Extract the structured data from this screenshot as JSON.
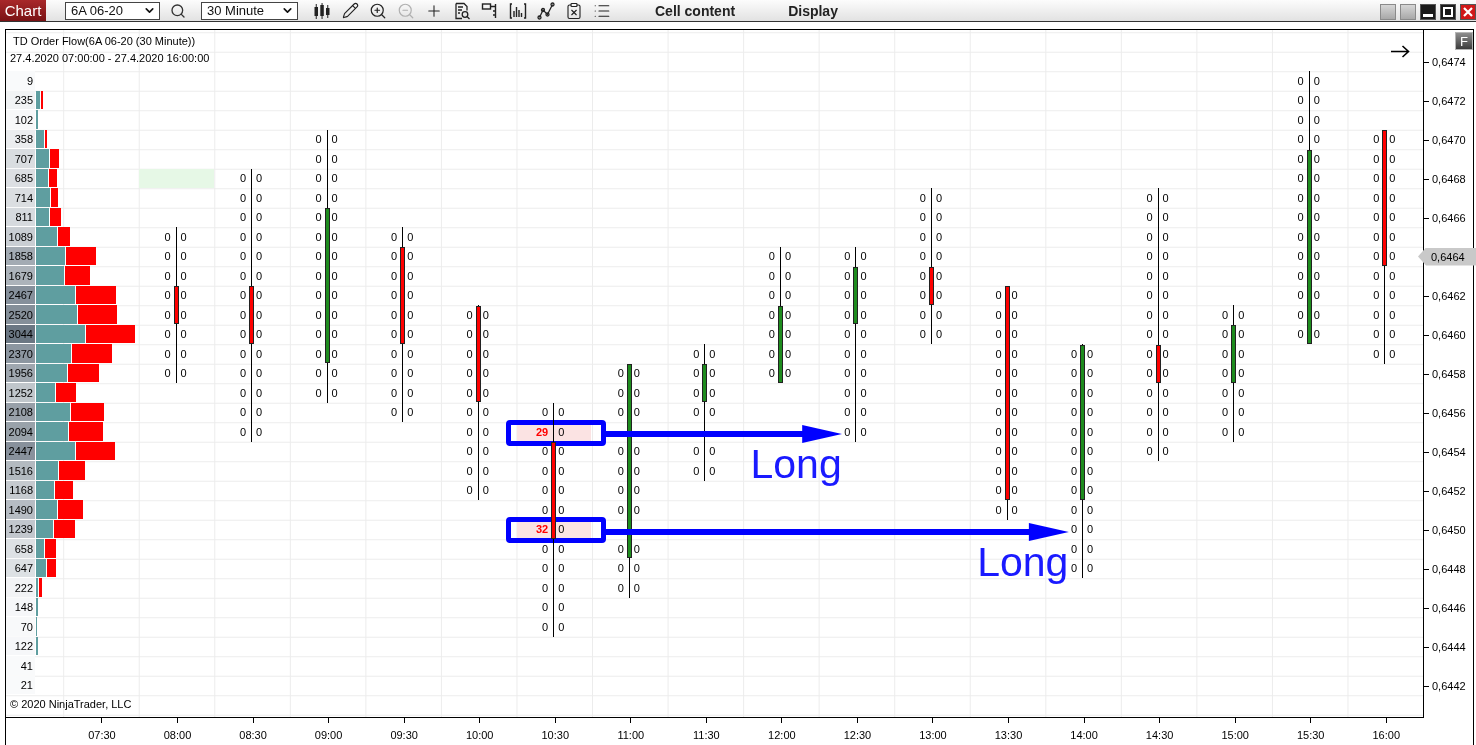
{
  "toolbar": {
    "tab": "Chart",
    "instrument": "6A 06-20",
    "interval": "30 Minute",
    "tools": [
      {
        "disabled": false
      },
      {
        "disabled": false
      },
      {
        "disabled": false
      },
      {
        "disabled": true
      },
      {
        "disabled": false
      },
      {
        "disabled": false
      },
      {
        "disabled": false
      },
      {
        "disabled": false
      },
      {
        "disabled": false
      },
      {
        "disabled": false
      },
      {
        "disabled": false
      }
    ],
    "menus": [
      "Cell content",
      "Display"
    ]
  },
  "chart": {
    "title": "TD Order Flow(6A 06-20 (30 Minute))",
    "range": "27.4.2020 07:00:00 - 27.4.2020 16:00:00",
    "copyright": "© 2020 NinjaTrader, LLC",
    "columns": [
      {
        "time": "07:30"
      },
      {
        "time": "08:00",
        "rising": false
      },
      {
        "time": "08:30",
        "rising": false
      },
      {
        "time": "09:00",
        "rising": true
      },
      {
        "time": "09:30",
        "rising": false
      },
      {
        "time": "10:00",
        "rising": false
      },
      {
        "time": "10:30",
        "rising": false
      },
      {
        "time": "11:00",
        "rising": true
      },
      {
        "time": "11:30",
        "rising": true
      },
      {
        "time": "12:00",
        "rising": true
      },
      {
        "time": "12:30",
        "rising": true
      },
      {
        "time": "13:00",
        "rising": false
      },
      {
        "time": "13:30",
        "rising": false
      },
      {
        "time": "14:00",
        "rising": true
      },
      {
        "time": "14:30",
        "rising": false
      },
      {
        "time": "15:00",
        "rising": true
      },
      {
        "time": "15:30",
        "rising": true
      },
      {
        "time": "16:00",
        "rising": false
      }
    ],
    "rows": [
      {
        "volume": "9",
        "cells": [
          null,
          null,
          null,
          null,
          null,
          null,
          null,
          null,
          null,
          null,
          null,
          null,
          null,
          null,
          null,
          null,
          {
            "kind": "plain",
            "bid": "0",
            "ask": "0",
            "body": false,
            "imbalance": false
          },
          null
        ]
      },
      {
        "volume": "235",
        "cells": [
          null,
          null,
          null,
          null,
          null,
          null,
          null,
          null,
          null,
          null,
          null,
          null,
          null,
          null,
          null,
          null,
          {
            "kind": "plain",
            "bid": "0",
            "ask": "0",
            "body": false,
            "imbalance": false
          },
          null
        ]
      },
      {
        "volume": "102",
        "cells": [
          null,
          null,
          null,
          null,
          null,
          null,
          null,
          null,
          null,
          null,
          null,
          null,
          null,
          null,
          null,
          null,
          {
            "kind": "plain",
            "bid": "0",
            "ask": "0",
            "body": false,
            "imbalance": false
          },
          null
        ]
      },
      {
        "volume": "358",
        "cells": [
          null,
          null,
          null,
          {
            "kind": "plain",
            "bid": "0",
            "ask": "0",
            "body": false,
            "imbalance": false
          },
          null,
          null,
          null,
          null,
          null,
          null,
          null,
          null,
          null,
          null,
          null,
          null,
          {
            "kind": "plain",
            "bid": "0",
            "ask": "0",
            "body": false,
            "imbalance": false
          },
          {
            "kind": "plain",
            "bid": "0",
            "ask": "0",
            "body": true,
            "imbalance": false
          }
        ]
      },
      {
        "volume": "707",
        "cells": [
          null,
          null,
          null,
          {
            "kind": "plain",
            "bid": "0",
            "ask": "0",
            "body": false,
            "imbalance": false
          },
          null,
          null,
          null,
          null,
          null,
          null,
          null,
          null,
          null,
          null,
          null,
          null,
          {
            "kind": "plain",
            "bid": "0",
            "ask": "0",
            "body": true,
            "imbalance": false
          },
          {
            "kind": "plain",
            "bid": "0",
            "ask": "0",
            "body": true,
            "imbalance": false
          }
        ]
      },
      {
        "volume": "685",
        "cells": [
          null,
          {
            "kind": "marker"
          },
          {
            "kind": "plain",
            "bid": "0",
            "ask": "0",
            "body": false,
            "imbalance": false
          },
          {
            "kind": "plain",
            "bid": "0",
            "ask": "0",
            "body": false,
            "imbalance": false
          },
          null,
          null,
          null,
          null,
          null,
          null,
          null,
          null,
          null,
          null,
          null,
          null,
          {
            "kind": "plain",
            "bid": "0",
            "ask": "0",
            "body": true,
            "imbalance": false
          },
          {
            "kind": "plain",
            "bid": "0",
            "ask": "0",
            "body": true,
            "imbalance": false
          }
        ]
      },
      {
        "volume": "714",
        "cells": [
          null,
          null,
          {
            "kind": "plain",
            "bid": "0",
            "ask": "0",
            "body": false,
            "imbalance": false
          },
          {
            "kind": "plain",
            "bid": "0",
            "ask": "0",
            "body": false,
            "imbalance": false
          },
          null,
          null,
          null,
          null,
          null,
          null,
          null,
          {
            "kind": "plain",
            "bid": "0",
            "ask": "0",
            "body": false,
            "imbalance": false
          },
          null,
          null,
          {
            "kind": "plain",
            "bid": "0",
            "ask": "0",
            "body": false,
            "imbalance": false
          },
          null,
          {
            "kind": "plain",
            "bid": "0",
            "ask": "0",
            "body": true,
            "imbalance": false
          },
          {
            "kind": "plain",
            "bid": "0",
            "ask": "0",
            "body": true,
            "imbalance": false
          }
        ]
      },
      {
        "volume": "811",
        "cells": [
          null,
          null,
          {
            "kind": "plain",
            "bid": "0",
            "ask": "0",
            "body": false,
            "imbalance": false
          },
          {
            "kind": "plain",
            "bid": "0",
            "ask": "0",
            "body": true,
            "imbalance": false
          },
          null,
          null,
          null,
          null,
          null,
          null,
          null,
          {
            "kind": "plain",
            "bid": "0",
            "ask": "0",
            "body": false,
            "imbalance": false
          },
          null,
          null,
          {
            "kind": "plain",
            "bid": "0",
            "ask": "0",
            "body": false,
            "imbalance": false
          },
          null,
          {
            "kind": "plain",
            "bid": "0",
            "ask": "0",
            "body": true,
            "imbalance": false
          },
          {
            "kind": "plain",
            "bid": "0",
            "ask": "0",
            "body": true,
            "imbalance": false
          }
        ]
      },
      {
        "volume": "1089",
        "cells": [
          null,
          {
            "kind": "plain",
            "bid": "0",
            "ask": "0",
            "body": false,
            "imbalance": false
          },
          {
            "kind": "plain",
            "bid": "0",
            "ask": "0",
            "body": false,
            "imbalance": false
          },
          {
            "kind": "plain",
            "bid": "0",
            "ask": "0",
            "body": true,
            "imbalance": false
          },
          {
            "kind": "plain",
            "bid": "0",
            "ask": "0",
            "body": false,
            "imbalance": false
          },
          null,
          null,
          null,
          null,
          null,
          null,
          {
            "kind": "plain",
            "bid": "0",
            "ask": "0",
            "body": false,
            "imbalance": false
          },
          null,
          null,
          {
            "kind": "plain",
            "bid": "0",
            "ask": "0",
            "body": false,
            "imbalance": false
          },
          null,
          {
            "kind": "plain",
            "bid": "0",
            "ask": "0",
            "body": true,
            "imbalance": false
          },
          {
            "kind": "plain",
            "bid": "0",
            "ask": "0",
            "body": true,
            "imbalance": false
          }
        ]
      },
      {
        "volume": "1858",
        "cells": [
          null,
          {
            "kind": "plain",
            "bid": "0",
            "ask": "0",
            "body": false,
            "imbalance": false
          },
          {
            "kind": "plain",
            "bid": "0",
            "ask": "0",
            "body": false,
            "imbalance": false
          },
          {
            "kind": "plain",
            "bid": "0",
            "ask": "0",
            "body": true,
            "imbalance": false
          },
          {
            "kind": "plain",
            "bid": "0",
            "ask": "0",
            "body": true,
            "imbalance": false
          },
          null,
          null,
          null,
          null,
          {
            "kind": "plain",
            "bid": "0",
            "ask": "0",
            "body": false,
            "imbalance": false
          },
          {
            "kind": "plain",
            "bid": "0",
            "ask": "0",
            "body": false,
            "imbalance": false
          },
          {
            "kind": "plain",
            "bid": "0",
            "ask": "0",
            "body": false,
            "imbalance": false
          },
          null,
          null,
          {
            "kind": "plain",
            "bid": "0",
            "ask": "0",
            "body": false,
            "imbalance": false
          },
          null,
          {
            "kind": "plain",
            "bid": "0",
            "ask": "0",
            "body": true,
            "imbalance": false
          },
          {
            "kind": "plain",
            "bid": "0",
            "ask": "0",
            "body": true,
            "imbalance": false
          }
        ]
      },
      {
        "volume": "1679",
        "cells": [
          null,
          {
            "kind": "plain",
            "bid": "0",
            "ask": "0",
            "body": false,
            "imbalance": false
          },
          {
            "kind": "plain",
            "bid": "0",
            "ask": "0",
            "body": false,
            "imbalance": false
          },
          {
            "kind": "plain",
            "bid": "0",
            "ask": "0",
            "body": true,
            "imbalance": false
          },
          {
            "kind": "plain",
            "bid": "0",
            "ask": "0",
            "body": true,
            "imbalance": false
          },
          null,
          null,
          null,
          null,
          {
            "kind": "plain",
            "bid": "0",
            "ask": "0",
            "body": false,
            "imbalance": false
          },
          {
            "kind": "plain",
            "bid": "0",
            "ask": "0",
            "body": true,
            "imbalance": false
          },
          {
            "kind": "plain",
            "bid": "0",
            "ask": "0",
            "body": true,
            "imbalance": false
          },
          null,
          null,
          {
            "kind": "plain",
            "bid": "0",
            "ask": "0",
            "body": false,
            "imbalance": false
          },
          null,
          {
            "kind": "plain",
            "bid": "0",
            "ask": "0",
            "body": true,
            "imbalance": false
          },
          {
            "kind": "plain",
            "bid": "0",
            "ask": "0",
            "body": false,
            "imbalance": false
          }
        ]
      },
      {
        "volume": "2467",
        "cells": [
          null,
          {
            "kind": "plain",
            "bid": "0",
            "ask": "0",
            "body": true,
            "imbalance": false
          },
          {
            "kind": "plain",
            "bid": "0",
            "ask": "0",
            "body": true,
            "imbalance": false
          },
          {
            "kind": "plain",
            "bid": "0",
            "ask": "0",
            "body": true,
            "imbalance": false
          },
          {
            "kind": "plain",
            "bid": "0",
            "ask": "0",
            "body": true,
            "imbalance": false
          },
          null,
          null,
          null,
          null,
          {
            "kind": "plain",
            "bid": "0",
            "ask": "0",
            "body": false,
            "imbalance": false
          },
          {
            "kind": "plain",
            "bid": "0",
            "ask": "0",
            "body": true,
            "imbalance": false
          },
          {
            "kind": "plain",
            "bid": "0",
            "ask": "0",
            "body": true,
            "imbalance": false
          },
          {
            "kind": "plain",
            "bid": "0",
            "ask": "0",
            "body": true,
            "imbalance": false
          },
          null,
          {
            "kind": "plain",
            "bid": "0",
            "ask": "0",
            "body": false,
            "imbalance": false
          },
          null,
          {
            "kind": "plain",
            "bid": "0",
            "ask": "0",
            "body": true,
            "imbalance": false
          },
          {
            "kind": "plain",
            "bid": "0",
            "ask": "0",
            "body": false,
            "imbalance": false
          }
        ]
      },
      {
        "volume": "2520",
        "cells": [
          null,
          {
            "kind": "plain",
            "bid": "0",
            "ask": "0",
            "body": true,
            "imbalance": false
          },
          {
            "kind": "plain",
            "bid": "0",
            "ask": "0",
            "body": true,
            "imbalance": false
          },
          {
            "kind": "plain",
            "bid": "0",
            "ask": "0",
            "body": true,
            "imbalance": false
          },
          {
            "kind": "plain",
            "bid": "0",
            "ask": "0",
            "body": true,
            "imbalance": false
          },
          {
            "kind": "plain",
            "bid": "0",
            "ask": "0",
            "body": true,
            "imbalance": false
          },
          null,
          null,
          null,
          {
            "kind": "plain",
            "bid": "0",
            "ask": "0",
            "body": true,
            "imbalance": false
          },
          {
            "kind": "plain",
            "bid": "0",
            "ask": "0",
            "body": true,
            "imbalance": false
          },
          {
            "kind": "plain",
            "bid": "0",
            "ask": "0",
            "body": false,
            "imbalance": false
          },
          {
            "kind": "plain",
            "bid": "0",
            "ask": "0",
            "body": true,
            "imbalance": false
          },
          null,
          {
            "kind": "plain",
            "bid": "0",
            "ask": "0",
            "body": false,
            "imbalance": false
          },
          {
            "kind": "plain",
            "bid": "0",
            "ask": "0",
            "body": false,
            "imbalance": false
          },
          {
            "kind": "plain",
            "bid": "0",
            "ask": "0",
            "body": true,
            "imbalance": false
          },
          {
            "kind": "plain",
            "bid": "0",
            "ask": "0",
            "body": false,
            "imbalance": false
          }
        ]
      },
      {
        "volume": "3044",
        "cells": [
          null,
          {
            "kind": "plain",
            "bid": "0",
            "ask": "0",
            "body": false,
            "imbalance": false
          },
          {
            "kind": "plain",
            "bid": "0",
            "ask": "0",
            "body": true,
            "imbalance": false
          },
          {
            "kind": "plain",
            "bid": "0",
            "ask": "0",
            "body": true,
            "imbalance": false
          },
          {
            "kind": "plain",
            "bid": "0",
            "ask": "0",
            "body": true,
            "imbalance": false
          },
          {
            "kind": "plain",
            "bid": "0",
            "ask": "0",
            "body": true,
            "imbalance": false
          },
          null,
          null,
          null,
          {
            "kind": "plain",
            "bid": "0",
            "ask": "0",
            "body": true,
            "imbalance": false
          },
          {
            "kind": "plain",
            "bid": "0",
            "ask": "0",
            "body": false,
            "imbalance": false
          },
          {
            "kind": "plain",
            "bid": "0",
            "ask": "0",
            "body": false,
            "imbalance": false
          },
          {
            "kind": "plain",
            "bid": "0",
            "ask": "0",
            "body": true,
            "imbalance": false
          },
          null,
          {
            "kind": "plain",
            "bid": "0",
            "ask": "0",
            "body": false,
            "imbalance": false
          },
          {
            "kind": "plain",
            "bid": "0",
            "ask": "0",
            "body": true,
            "imbalance": false
          },
          {
            "kind": "plain",
            "bid": "0",
            "ask": "0",
            "body": true,
            "imbalance": false
          },
          {
            "kind": "plain",
            "bid": "0",
            "ask": "0",
            "body": false,
            "imbalance": false
          }
        ]
      },
      {
        "volume": "2370",
        "cells": [
          null,
          {
            "kind": "plain",
            "bid": "0",
            "ask": "0",
            "body": false,
            "imbalance": false
          },
          {
            "kind": "plain",
            "bid": "0",
            "ask": "0",
            "body": false,
            "imbalance": false
          },
          {
            "kind": "plain",
            "bid": "0",
            "ask": "0",
            "body": true,
            "imbalance": false
          },
          {
            "kind": "plain",
            "bid": "0",
            "ask": "0",
            "body": false,
            "imbalance": false
          },
          {
            "kind": "plain",
            "bid": "0",
            "ask": "0",
            "body": true,
            "imbalance": false
          },
          null,
          null,
          {
            "kind": "plain",
            "bid": "0",
            "ask": "0",
            "body": false,
            "imbalance": false
          },
          {
            "kind": "plain",
            "bid": "0",
            "ask": "0",
            "body": true,
            "imbalance": false
          },
          {
            "kind": "plain",
            "bid": "0",
            "ask": "0",
            "body": false,
            "imbalance": false
          },
          null,
          {
            "kind": "plain",
            "bid": "0",
            "ask": "0",
            "body": true,
            "imbalance": false
          },
          {
            "kind": "plain",
            "bid": "0",
            "ask": "0",
            "body": true,
            "imbalance": false
          },
          {
            "kind": "plain",
            "bid": "0",
            "ask": "0",
            "body": true,
            "imbalance": false
          },
          {
            "kind": "plain",
            "bid": "0",
            "ask": "0",
            "body": true,
            "imbalance": false
          },
          null,
          {
            "kind": "plain",
            "bid": "0",
            "ask": "0",
            "body": false,
            "imbalance": false
          }
        ]
      },
      {
        "volume": "1956",
        "cells": [
          null,
          {
            "kind": "plain",
            "bid": "0",
            "ask": "0",
            "body": false,
            "imbalance": false
          },
          {
            "kind": "plain",
            "bid": "0",
            "ask": "0",
            "body": false,
            "imbalance": false
          },
          {
            "kind": "plain",
            "bid": "0",
            "ask": "0",
            "body": false,
            "imbalance": false
          },
          {
            "kind": "plain",
            "bid": "0",
            "ask": "0",
            "body": false,
            "imbalance": false
          },
          {
            "kind": "plain",
            "bid": "0",
            "ask": "0",
            "body": true,
            "imbalance": false
          },
          null,
          {
            "kind": "plain",
            "bid": "0",
            "ask": "0",
            "body": true,
            "imbalance": false
          },
          {
            "kind": "plain",
            "bid": "0",
            "ask": "0",
            "body": true,
            "imbalance": false
          },
          {
            "kind": "plain",
            "bid": "0",
            "ask": "0",
            "body": true,
            "imbalance": false
          },
          {
            "kind": "plain",
            "bid": "0",
            "ask": "0",
            "body": false,
            "imbalance": false
          },
          null,
          {
            "kind": "plain",
            "bid": "0",
            "ask": "0",
            "body": true,
            "imbalance": false
          },
          {
            "kind": "plain",
            "bid": "0",
            "ask": "0",
            "body": true,
            "imbalance": false
          },
          {
            "kind": "plain",
            "bid": "0",
            "ask": "0",
            "body": true,
            "imbalance": false
          },
          {
            "kind": "plain",
            "bid": "0",
            "ask": "0",
            "body": true,
            "imbalance": false
          },
          null,
          null
        ]
      },
      {
        "volume": "1252",
        "cells": [
          null,
          null,
          {
            "kind": "plain",
            "bid": "0",
            "ask": "0",
            "body": false,
            "imbalance": false
          },
          {
            "kind": "plain",
            "bid": "0",
            "ask": "0",
            "body": false,
            "imbalance": false
          },
          {
            "kind": "plain",
            "bid": "0",
            "ask": "0",
            "body": false,
            "imbalance": false
          },
          {
            "kind": "plain",
            "bid": "0",
            "ask": "0",
            "body": true,
            "imbalance": false
          },
          null,
          {
            "kind": "plain",
            "bid": "0",
            "ask": "0",
            "body": true,
            "imbalance": false
          },
          {
            "kind": "plain",
            "bid": "0",
            "ask": "0",
            "body": true,
            "imbalance": false
          },
          null,
          {
            "kind": "plain",
            "bid": "0",
            "ask": "0",
            "body": false,
            "imbalance": false
          },
          null,
          {
            "kind": "plain",
            "bid": "0",
            "ask": "0",
            "body": true,
            "imbalance": false
          },
          {
            "kind": "plain",
            "bid": "0",
            "ask": "0",
            "body": true,
            "imbalance": false
          },
          {
            "kind": "plain",
            "bid": "0",
            "ask": "0",
            "body": false,
            "imbalance": false
          },
          {
            "kind": "plain",
            "bid": "0",
            "ask": "0",
            "body": false,
            "imbalance": false
          },
          null,
          null
        ]
      },
      {
        "volume": "2108",
        "cells": [
          null,
          null,
          {
            "kind": "plain",
            "bid": "0",
            "ask": "0",
            "body": false,
            "imbalance": false
          },
          null,
          {
            "kind": "plain",
            "bid": "0",
            "ask": "0",
            "body": false,
            "imbalance": false
          },
          {
            "kind": "plain",
            "bid": "0",
            "ask": "0",
            "body": false,
            "imbalance": false
          },
          {
            "kind": "plain",
            "bid": "0",
            "ask": "0",
            "body": false,
            "imbalance": false
          },
          {
            "kind": "plain",
            "bid": "0",
            "ask": "0",
            "body": true,
            "imbalance": false
          },
          {
            "kind": "plain",
            "bid": "0",
            "ask": "0",
            "body": false,
            "imbalance": false
          },
          null,
          {
            "kind": "plain",
            "bid": "0",
            "ask": "0",
            "body": false,
            "imbalance": false
          },
          null,
          {
            "kind": "plain",
            "bid": "0",
            "ask": "0",
            "body": true,
            "imbalance": false
          },
          {
            "kind": "plain",
            "bid": "0",
            "ask": "0",
            "body": true,
            "imbalance": false
          },
          {
            "kind": "plain",
            "bid": "0",
            "ask": "0",
            "body": false,
            "imbalance": false
          },
          {
            "kind": "plain",
            "bid": "0",
            "ask": "0",
            "body": false,
            "imbalance": false
          },
          null,
          null
        ]
      },
      {
        "volume": "2094",
        "cells": [
          null,
          null,
          {
            "kind": "plain",
            "bid": "0",
            "ask": "0",
            "body": false,
            "imbalance": false
          },
          null,
          null,
          {
            "kind": "plain",
            "bid": "0",
            "ask": "0",
            "body": false,
            "imbalance": false
          },
          {
            "kind": "boxed",
            "bid": "29",
            "ask": "0",
            "body": false,
            "imbalance": true
          },
          {
            "kind": "covered"
          },
          {
            "kind": "covered"
          },
          null,
          {
            "kind": "target",
            "bid": "0",
            "ask": "0",
            "body": false,
            "imbalance": false,
            "label": "Long"
          },
          null,
          {
            "kind": "plain",
            "bid": "0",
            "ask": "0",
            "body": true,
            "imbalance": false
          },
          {
            "kind": "plain",
            "bid": "0",
            "ask": "0",
            "body": true,
            "imbalance": false
          },
          {
            "kind": "plain",
            "bid": "0",
            "ask": "0",
            "body": false,
            "imbalance": false
          },
          {
            "kind": "plain",
            "bid": "0",
            "ask": "0",
            "body": false,
            "imbalance": false
          },
          null,
          null
        ]
      },
      {
        "volume": "2447",
        "cells": [
          null,
          null,
          null,
          null,
          null,
          {
            "kind": "plain",
            "bid": "0",
            "ask": "0",
            "body": false,
            "imbalance": false
          },
          {
            "kind": "plain",
            "bid": "0",
            "ask": "0",
            "body": true,
            "imbalance": false
          },
          {
            "kind": "plain",
            "bid": "0",
            "ask": "0",
            "body": true,
            "imbalance": false
          },
          {
            "kind": "plain",
            "bid": "0",
            "ask": "0",
            "body": false,
            "imbalance": false
          },
          null,
          null,
          null,
          {
            "kind": "plain",
            "bid": "0",
            "ask": "0",
            "body": true,
            "imbalance": false
          },
          {
            "kind": "plain",
            "bid": "0",
            "ask": "0",
            "body": true,
            "imbalance": false
          },
          {
            "kind": "plain",
            "bid": "0",
            "ask": "0",
            "body": false,
            "imbalance": false
          },
          null,
          null,
          null
        ]
      },
      {
        "volume": "1516",
        "cells": [
          null,
          null,
          null,
          null,
          null,
          {
            "kind": "plain",
            "bid": "0",
            "ask": "0",
            "body": false,
            "imbalance": false
          },
          {
            "kind": "plain",
            "bid": "0",
            "ask": "0",
            "body": true,
            "imbalance": false
          },
          {
            "kind": "plain",
            "bid": "0",
            "ask": "0",
            "body": true,
            "imbalance": false
          },
          {
            "kind": "plain",
            "bid": "0",
            "ask": "0",
            "body": false,
            "imbalance": false
          },
          null,
          null,
          null,
          {
            "kind": "plain",
            "bid": "0",
            "ask": "0",
            "body": true,
            "imbalance": false
          },
          {
            "kind": "plain",
            "bid": "0",
            "ask": "0",
            "body": true,
            "imbalance": false
          },
          null,
          null,
          null,
          null
        ]
      },
      {
        "volume": "1168",
        "cells": [
          null,
          null,
          null,
          null,
          null,
          {
            "kind": "plain",
            "bid": "0",
            "ask": "0",
            "body": false,
            "imbalance": false
          },
          {
            "kind": "plain",
            "bid": "0",
            "ask": "0",
            "body": true,
            "imbalance": false
          },
          {
            "kind": "plain",
            "bid": "0",
            "ask": "0",
            "body": true,
            "imbalance": false
          },
          null,
          null,
          null,
          null,
          {
            "kind": "plain",
            "bid": "0",
            "ask": "0",
            "body": true,
            "imbalance": false
          },
          {
            "kind": "plain",
            "bid": "0",
            "ask": "0",
            "body": true,
            "imbalance": false
          },
          null,
          null,
          null,
          null
        ]
      },
      {
        "volume": "1490",
        "cells": [
          null,
          null,
          null,
          null,
          null,
          null,
          {
            "kind": "plain",
            "bid": "0",
            "ask": "0",
            "body": true,
            "imbalance": false
          },
          {
            "kind": "plain",
            "bid": "0",
            "ask": "0",
            "body": true,
            "imbalance": false
          },
          null,
          null,
          null,
          null,
          {
            "kind": "plain",
            "bid": "0",
            "ask": "0",
            "body": false,
            "imbalance": false
          },
          {
            "kind": "plain",
            "bid": "0",
            "ask": "0",
            "body": false,
            "imbalance": false
          },
          null,
          null,
          null,
          null
        ]
      },
      {
        "volume": "1239",
        "cells": [
          null,
          null,
          null,
          null,
          null,
          null,
          {
            "kind": "boxed",
            "bid": "32",
            "ask": "0",
            "body": true,
            "imbalance": true
          },
          {
            "kind": "covered"
          },
          null,
          null,
          null,
          null,
          null,
          {
            "kind": "target",
            "bid": "0",
            "ask": "0",
            "body": false,
            "imbalance": false,
            "label": "Long"
          },
          null,
          null,
          null,
          null
        ]
      },
      {
        "volume": "658",
        "cells": [
          null,
          null,
          null,
          null,
          null,
          null,
          {
            "kind": "plain",
            "bid": "0",
            "ask": "0",
            "body": false,
            "imbalance": false
          },
          {
            "kind": "plain",
            "bid": "0",
            "ask": "0",
            "body": true,
            "imbalance": false
          },
          null,
          null,
          null,
          null,
          null,
          {
            "kind": "plain",
            "bid": "0",
            "ask": "0",
            "body": false,
            "imbalance": false
          },
          null,
          null,
          null,
          null
        ]
      },
      {
        "volume": "647",
        "cells": [
          null,
          null,
          null,
          null,
          null,
          null,
          {
            "kind": "plain",
            "bid": "0",
            "ask": "0",
            "body": false,
            "imbalance": false
          },
          {
            "kind": "plain",
            "bid": "0",
            "ask": "0",
            "body": false,
            "imbalance": false
          },
          null,
          null,
          null,
          null,
          null,
          {
            "kind": "plain",
            "bid": "0",
            "ask": "0",
            "body": false,
            "imbalance": false
          },
          null,
          null,
          null,
          null
        ]
      },
      {
        "volume": "222",
        "cells": [
          null,
          null,
          null,
          null,
          null,
          null,
          {
            "kind": "plain",
            "bid": "0",
            "ask": "0",
            "body": false,
            "imbalance": false
          },
          {
            "kind": "plain",
            "bid": "0",
            "ask": "0",
            "body": false,
            "imbalance": false
          },
          null,
          null,
          null,
          null,
          null,
          null,
          null,
          null,
          null,
          null
        ]
      },
      {
        "volume": "148",
        "cells": [
          null,
          null,
          null,
          null,
          null,
          null,
          {
            "kind": "plain",
            "bid": "0",
            "ask": "0",
            "body": false,
            "imbalance": false
          },
          null,
          null,
          null,
          null,
          null,
          null,
          null,
          null,
          null,
          null,
          null
        ]
      },
      {
        "volume": "70",
        "cells": [
          null,
          null,
          null,
          null,
          null,
          null,
          {
            "kind": "plain",
            "bid": "0",
            "ask": "0",
            "body": false,
            "imbalance": false
          },
          null,
          null,
          null,
          null,
          null,
          null,
          null,
          null,
          null,
          null,
          null
        ]
      },
      {
        "volume": "122"
      },
      {
        "volume": "41"
      },
      {
        "volume": "21"
      }
    ],
    "price_axis": {
      "button": "F",
      "ticks": [
        "0,6474",
        "0,6472",
        "0,6470",
        "0,6468",
        "0,6466",
        "0,6462",
        "0,6460",
        "0,6458",
        "0,6456",
        "0,6454",
        "0,6452",
        "0,6450",
        "0,6448",
        "0,6446",
        "0,6444",
        "0,6442"
      ],
      "current_price": "0,6464"
    }
  }
}
